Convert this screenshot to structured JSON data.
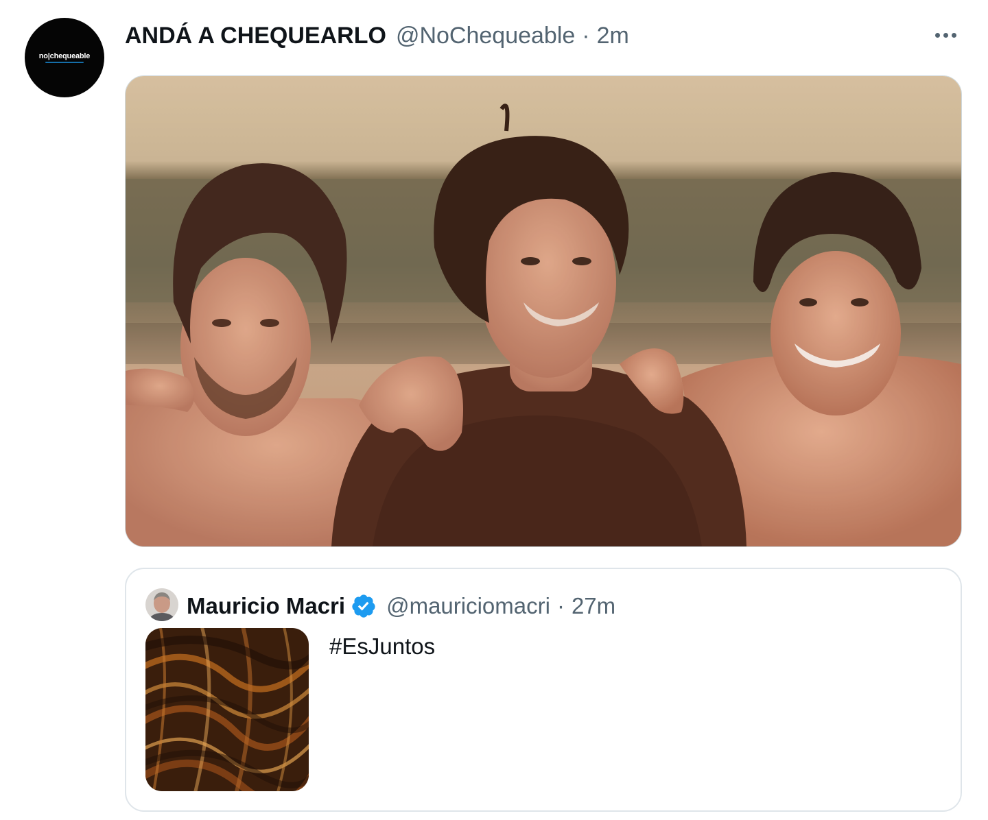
{
  "tweet": {
    "author": {
      "display_name": "ANDÁ A CHEQUEARLO",
      "handle": "@NoChequeable",
      "avatar_logo_text": "no|chequeable"
    },
    "separator": "·",
    "time": "2m",
    "more_icon": "more-horizontal-icon",
    "media": {
      "description_icon": "photo"
    },
    "quoted": {
      "author": {
        "display_name": "Mauricio Macri",
        "handle": "@mauriciomacri",
        "verified": true
      },
      "separator": "·",
      "time": "27m",
      "text": "#EsJuntos"
    }
  },
  "colors": {
    "secondary_text": "#536471",
    "verified_blue": "#1d9bf0",
    "border": "#cfd9de"
  }
}
